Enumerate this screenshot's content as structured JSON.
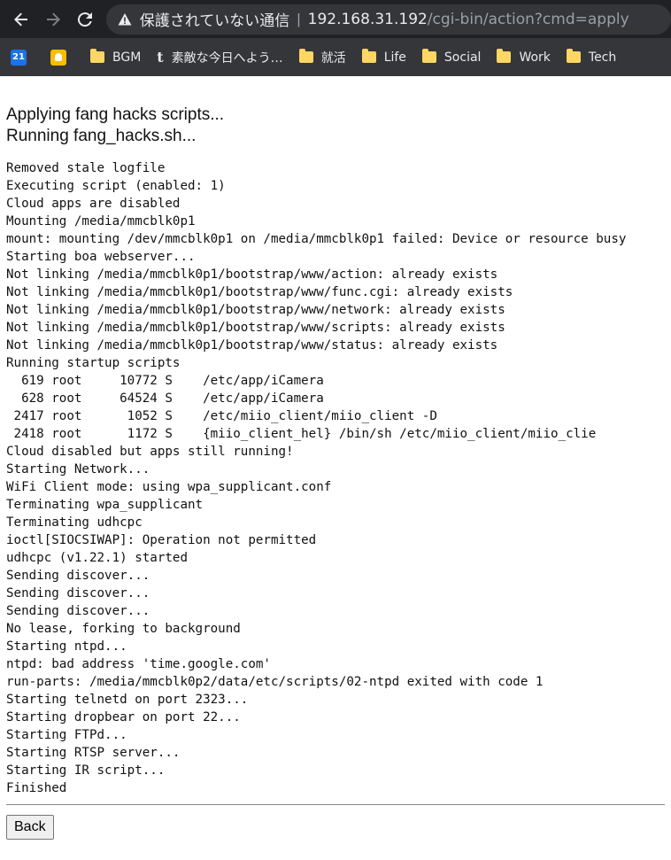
{
  "browser": {
    "security_label": "保護されていない通信",
    "url_host": "192.168.31.192",
    "url_path": "/cgi-bin/action?cmd=apply",
    "bookmarks": [
      {
        "label": "",
        "icon": "calendar-icon"
      },
      {
        "label": "",
        "icon": "keep-icon"
      },
      {
        "label": "BGM",
        "icon": "folder-icon"
      },
      {
        "label": "素敵な今日へよう…",
        "icon": "tumblr-icon"
      },
      {
        "label": "就活",
        "icon": "folder-icon"
      },
      {
        "label": "Life",
        "icon": "folder-icon"
      },
      {
        "label": "Social",
        "icon": "folder-icon"
      },
      {
        "label": "Work",
        "icon": "folder-icon"
      },
      {
        "label": "Tech",
        "icon": "folder-icon"
      }
    ],
    "calendar_day": "21"
  },
  "page": {
    "heading_1": "Applying fang hacks scripts...",
    "heading_2": "Running fang_hacks.sh...",
    "log": "Removed stale logfile\nExecuting script (enabled: 1)\nCloud apps are disabled\nMounting /media/mmcblk0p1\nmount: mounting /dev/mmcblk0p1 on /media/mmcblk0p1 failed: Device or resource busy\nStarting boa webserver...\nNot linking /media/mmcblk0p1/bootstrap/www/action: already exists\nNot linking /media/mmcblk0p1/bootstrap/www/func.cgi: already exists\nNot linking /media/mmcblk0p1/bootstrap/www/network: already exists\nNot linking /media/mmcblk0p1/bootstrap/www/scripts: already exists\nNot linking /media/mmcblk0p1/bootstrap/www/status: already exists\nRunning startup scripts\n  619 root     10772 S    /etc/app/iCamera\n  628 root     64524 S    /etc/app/iCamera\n 2417 root      1052 S    /etc/miio_client/miio_client -D\n 2418 root      1172 S    {miio_client_hel} /bin/sh /etc/miio_client/miio_clie\nCloud disabled but apps still running!\nStarting Network...\nWiFi Client mode: using wpa_supplicant.conf\nTerminating wpa_supplicant\nTerminating udhcpc\nioctl[SIOCSIWAP]: Operation not permitted\nudhcpc (v1.22.1) started\nSending discover...\nSending discover...\nSending discover...\nNo lease, forking to background\nStarting ntpd...\nntpd: bad address 'time.google.com'\nrun-parts: /media/mmcblk0p2/data/etc/scripts/02-ntpd exited with code 1\nStarting telnetd on port 2323...\nStarting dropbear on port 22...\nStarting FTPd...\nStarting RTSP server...\nStarting IR script...\nFinished",
    "back_label": "Back"
  }
}
